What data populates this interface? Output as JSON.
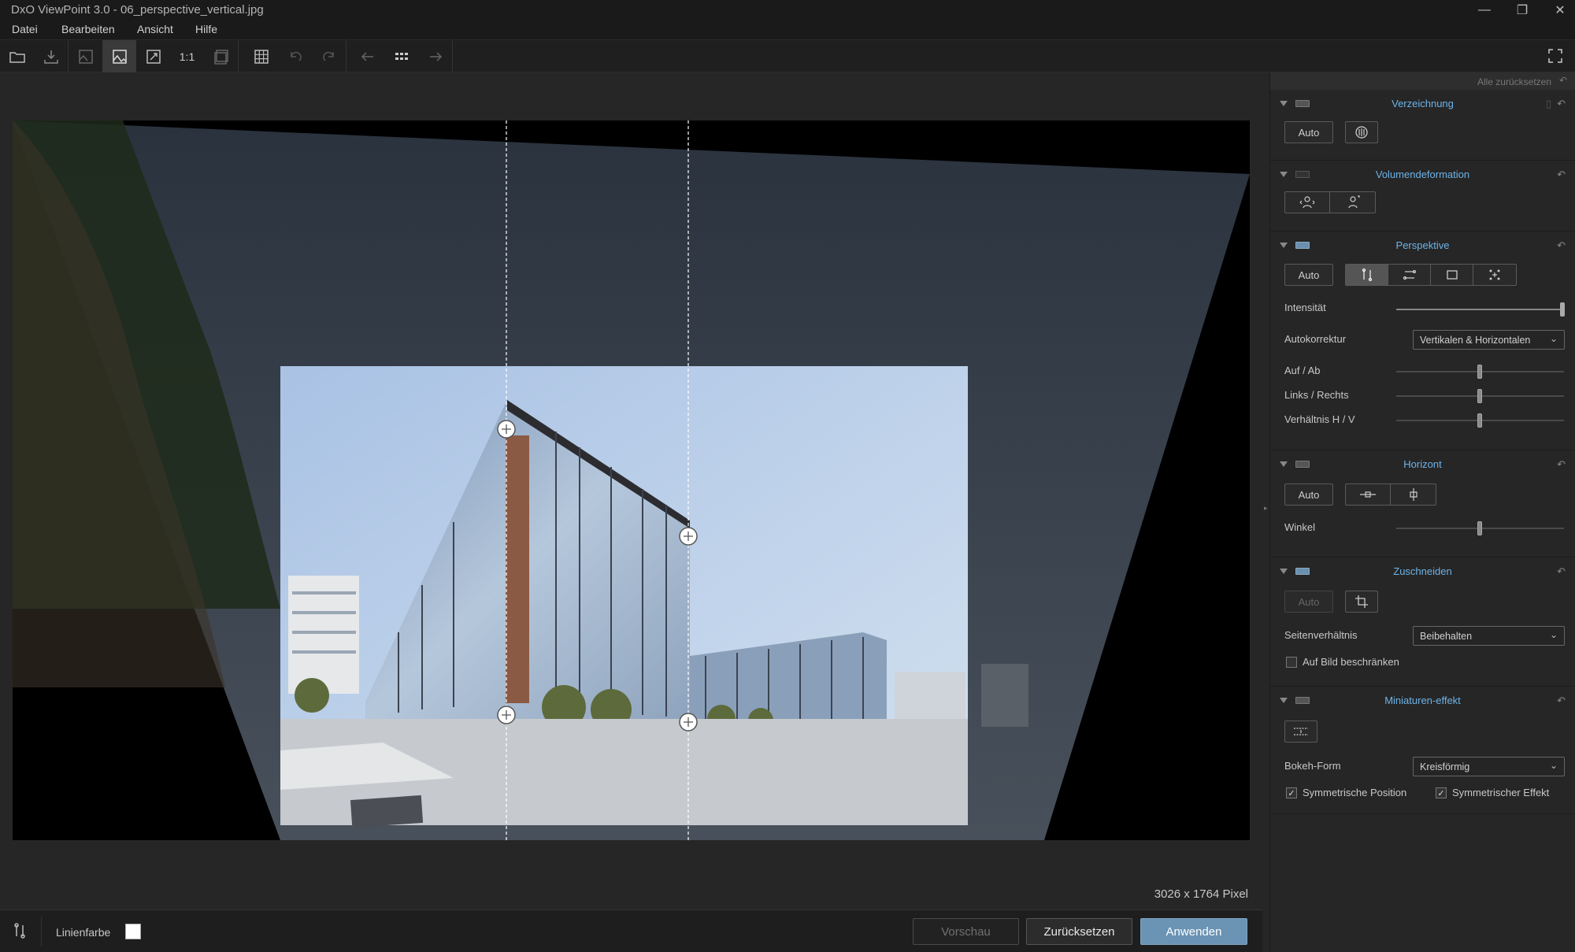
{
  "window": {
    "title": "DxO ViewPoint 3.0 - 06_perspective_vertical.jpg",
    "minimize": "—",
    "restore": "❐",
    "close": "✕"
  },
  "menu": [
    "Datei",
    "Bearbeiten",
    "Ansicht",
    "Hilfe"
  ],
  "toolbar": {
    "zoom_label": "1:1"
  },
  "canvas": {
    "pixel_info": "3026 x 1764 Pixel"
  },
  "bottombar": {
    "line_color_label": "Linienfarbe",
    "line_color": "#ffffff",
    "preview": "Vorschau",
    "reset": "Zurücksetzen",
    "apply": "Anwenden"
  },
  "panel": {
    "reset_all": "Alle zurücksetzen",
    "verzeichnung": {
      "title": "Verzeichnung",
      "auto": "Auto"
    },
    "volumen": {
      "title": "Volumendeformation"
    },
    "perspektive": {
      "title": "Perspektive",
      "auto": "Auto",
      "intensity_label": "Intensität",
      "intensity_value": 1.0,
      "autocorrect_label": "Autokorrektur",
      "autocorrect_value": "Vertikalen & Horizontalen",
      "updown_label": "Auf / Ab",
      "leftright_label": "Links / Rechts",
      "ratio_label": "Verhältnis H / V"
    },
    "horizont": {
      "title": "Horizont",
      "auto": "Auto",
      "angle_label": "Winkel"
    },
    "zuschneiden": {
      "title": "Zuschneiden",
      "auto": "Auto",
      "ratio_label": "Seitenverhältnis",
      "ratio_value": "Beibehalten",
      "restrict_label": "Auf Bild beschränken"
    },
    "miniatur": {
      "title": "Miniaturen-effekt",
      "bokeh_label": "Bokeh-Form",
      "bokeh_value": "Kreisförmig",
      "sym_pos": "Symmetrische Position",
      "sym_effect": "Symmetrischer Effekt"
    }
  }
}
